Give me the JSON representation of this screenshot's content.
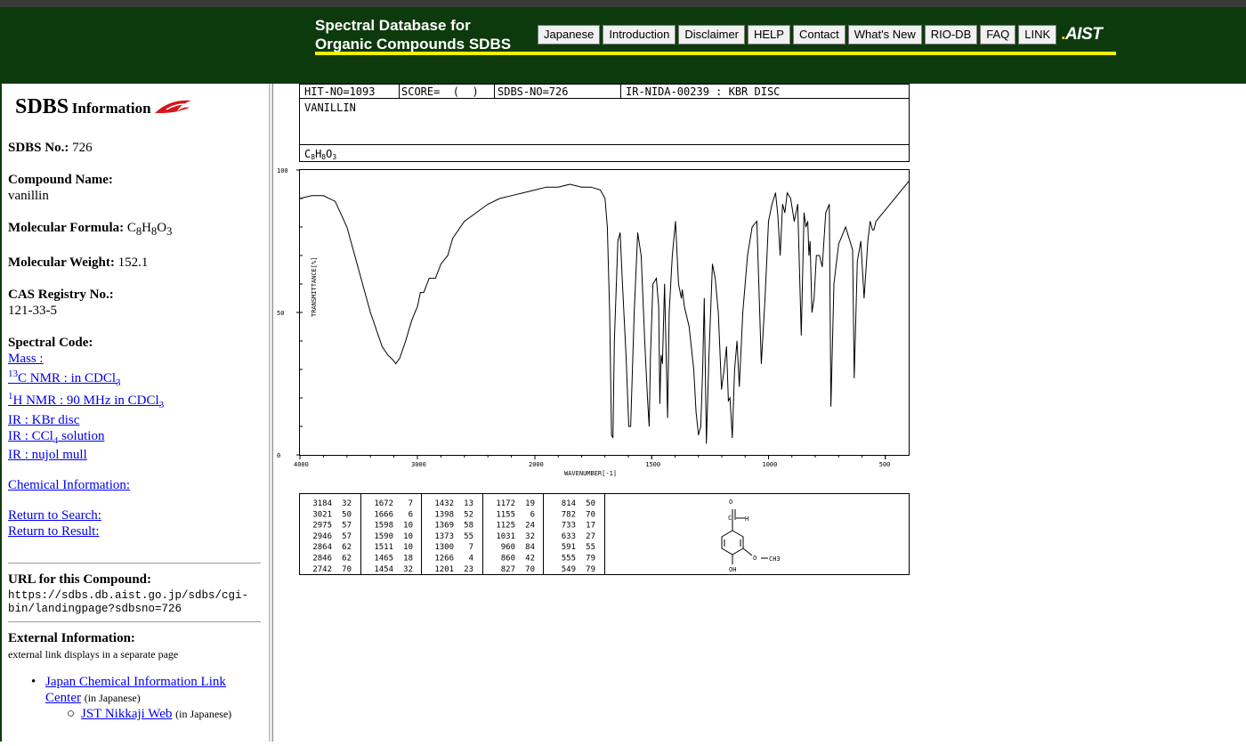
{
  "header": {
    "title_line1": "Spectral Database for",
    "title_line2": "Organic Compounds SDBS",
    "nav": [
      "Japanese",
      "Introduction",
      "Disclaimer",
      "HELP",
      "Contact",
      "What's New",
      "RIO-DB",
      "FAQ",
      "LINK"
    ],
    "brand_logo": "AIST"
  },
  "sidebar": {
    "heading_big": "SDBS",
    "heading_small": "Information",
    "sdbs_no_label": "SDBS No.:",
    "sdbs_no": "726",
    "compound_label": "Compound Name:",
    "compound": "vanillin",
    "formula_label": "Molecular Formula:",
    "weight_label": "Molecular Weight:",
    "weight": "152.1",
    "cas_label": "CAS Registry No.:",
    "cas": "121-33-5",
    "spectral_label": "Spectral Code:",
    "mass": "Mass :",
    "c13_sup": "13",
    "c13_text": "C NMR : in CDCl",
    "c13_sub": "3",
    "h1_sup": "1",
    "h1_text": "H NMR : 90 MHz in CDCl",
    "h1_sub": "3",
    "ir_kbr": "IR : KBr disc",
    "ir_ccl4_text": "IR : CCl",
    "ir_ccl4_sub": "4",
    "ir_ccl4_tail": " solution",
    "ir_nujol": "IR : nujol mull",
    "chem_info": "Chemical Information:",
    "return_search": "Return to Search:",
    "return_result": "Return to Result:",
    "url_label": "URL for this Compound:",
    "url_line1": "https://sdbs.db.aist.go.jp/sdbs/cgi-",
    "url_line2": "bin/landingpage?sdbsno=726",
    "external_label": "External Information:",
    "external_note": "external link displays in a separate page",
    "jcilc_line1": "Japan Chemical Information Link",
    "jcilc_line2": "Center",
    "in_japanese": "(in Japanese)",
    "jst": "JST Nikkaji Web"
  },
  "spectrum": {
    "hit_no": "HIT-NO=1093",
    "score": "SCORE=  (  )",
    "sdbs_no": "SDBS-NO=726",
    "ir_code": "IR-NIDA-00239 : KBR DISC",
    "compound_upper": "VANILLIN",
    "y_axis_label": "TRANSMITTANCE[%]",
    "x_axis_label": "WAVENUMBER[-1]",
    "y_ticks": [
      "100",
      "50",
      "0"
    ],
    "x_ticks": [
      "4000",
      "3000",
      "2000",
      "1500",
      "1000",
      "500"
    ],
    "peak_table": [
      [
        [
          "3184",
          "32"
        ],
        [
          "3021",
          "50"
        ],
        [
          "2975",
          "57"
        ],
        [
          "2946",
          "57"
        ],
        [
          "2864",
          "62"
        ],
        [
          "2846",
          "62"
        ],
        [
          "2742",
          "70"
        ]
      ],
      [
        [
          "1672",
          "7"
        ],
        [
          "1666",
          "6"
        ],
        [
          "1598",
          "10"
        ],
        [
          "1590",
          "10"
        ],
        [
          "1511",
          "10"
        ],
        [
          "1465",
          "18"
        ],
        [
          "1454",
          "32"
        ]
      ],
      [
        [
          "1432",
          "13"
        ],
        [
          "1398",
          "52"
        ],
        [
          "1369",
          "58"
        ],
        [
          "1373",
          "55"
        ],
        [
          "1300",
          "7"
        ],
        [
          "1266",
          "4"
        ],
        [
          "1201",
          "23"
        ]
      ],
      [
        [
          "1172",
          "19"
        ],
        [
          "1155",
          "6"
        ],
        [
          "1125",
          "24"
        ],
        [
          "1031",
          "32"
        ],
        [
          "960",
          "84"
        ],
        [
          "860",
          "42"
        ],
        [
          "827",
          "70"
        ]
      ],
      [
        [
          "814",
          "50"
        ],
        [
          "782",
          "70"
        ],
        [
          "733",
          "17"
        ],
        [
          "633",
          "27"
        ],
        [
          "591",
          "55"
        ],
        [
          "555",
          "79"
        ],
        [
          "549",
          "79"
        ]
      ]
    ],
    "structure_labels": [
      "O",
      "C",
      "H",
      "O",
      "CH3",
      "OH"
    ]
  },
  "chart_data": {
    "type": "line",
    "title": "",
    "xlabel": "WAVENUMBER[-1]",
    "ylabel": "TRANSMITTANCE[%]",
    "xlim": [
      4000,
      400
    ],
    "ylim": [
      0,
      100
    ],
    "series": [
      {
        "x": [
          4000,
          3900,
          3800,
          3700,
          3600,
          3500,
          3400,
          3300,
          3250,
          3200,
          3184,
          3150,
          3100,
          3050,
          3021,
          3000,
          2975,
          2946,
          2900,
          2864,
          2846,
          2800,
          2742,
          2700,
          2600,
          2500,
          2400,
          2300,
          2200,
          2100,
          2000,
          1950,
          1900,
          1850,
          1800,
          1760,
          1720,
          1700,
          1690,
          1680,
          1672,
          1666,
          1660,
          1645,
          1635,
          1625,
          1610,
          1598,
          1590,
          1575,
          1560,
          1545,
          1530,
          1518,
          1511,
          1505,
          1495,
          1480,
          1470,
          1465,
          1460,
          1454,
          1445,
          1432,
          1425,
          1412,
          1398,
          1385,
          1373,
          1369,
          1360,
          1340,
          1320,
          1310,
          1300,
          1290,
          1282,
          1275,
          1266,
          1255,
          1240,
          1228,
          1215,
          1201,
          1190,
          1180,
          1172,
          1165,
          1155,
          1145,
          1135,
          1125,
          1110,
          1090,
          1070,
          1050,
          1031,
          1015,
          1000,
          985,
          970,
          960,
          950,
          940,
          930,
          920,
          905,
          890,
          875,
          860,
          848,
          840,
          832,
          827,
          822,
          814,
          805,
          795,
          782,
          770,
          755,
          740,
          733,
          720,
          700,
          670,
          640,
          633,
          620,
          605,
          591,
          575,
          565,
          555,
          549,
          540,
          520,
          500,
          480,
          460,
          440,
          420,
          400
        ],
        "y": [
          90,
          91,
          91,
          89,
          80,
          65,
          50,
          38,
          35,
          33,
          32,
          34,
          40,
          47,
          50,
          52,
          57,
          57,
          62,
          62,
          62,
          67,
          70,
          76,
          82,
          85,
          88,
          90,
          91,
          92,
          93,
          94,
          94,
          95,
          94,
          94,
          93,
          90,
          80,
          50,
          7,
          6,
          40,
          75,
          78,
          60,
          35,
          10,
          10,
          50,
          78,
          70,
          40,
          20,
          10,
          35,
          60,
          62,
          52,
          18,
          35,
          32,
          60,
          13,
          50,
          70,
          82,
          60,
          55,
          58,
          52,
          45,
          30,
          15,
          7,
          10,
          30,
          55,
          4,
          35,
          67,
          62,
          50,
          23,
          30,
          38,
          19,
          20,
          6,
          30,
          40,
          24,
          50,
          70,
          80,
          82,
          32,
          55,
          82,
          88,
          92,
          84,
          70,
          88,
          85,
          92,
          90,
          82,
          88,
          42,
          85,
          80,
          82,
          70,
          75,
          50,
          55,
          70,
          70,
          66,
          85,
          88,
          17,
          60,
          74,
          80,
          72,
          27,
          68,
          75,
          55,
          75,
          82,
          79,
          79,
          82,
          84,
          86,
          88,
          90,
          92,
          94,
          96
        ]
      }
    ]
  }
}
